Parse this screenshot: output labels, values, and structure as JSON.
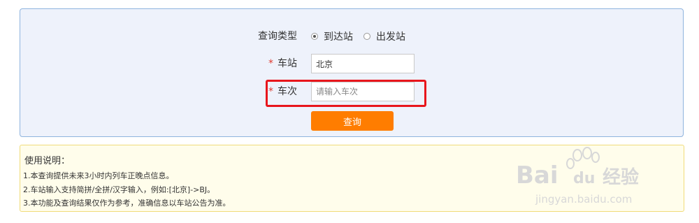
{
  "query_form": {
    "type_label": "查询类型",
    "type_options": [
      {
        "label": "到达站",
        "checked": true
      },
      {
        "label": "出发站",
        "checked": false
      }
    ],
    "station": {
      "label": "车站",
      "value": "北京"
    },
    "train": {
      "label": "车次",
      "value": "",
      "placeholder": "请输入车次"
    },
    "required_mark": "*",
    "submit_label": "查询"
  },
  "help": {
    "title": "使用说明：",
    "lines": [
      "1.本查询提供未来3小时内列车正晚点信息。",
      "2.车站输入支持简拼/全拼/汉字输入，例如:[北京]->BJ。",
      "3.本功能及查询结果仅作为参考，准确信息以车站公告为准。"
    ]
  },
  "watermark": {
    "brand": "Bai",
    "brand_du": "du",
    "brand_cn": "经验",
    "url": "jingyan.baidu.com"
  },
  "colors": {
    "accent": "#ff7d00",
    "highlight": "#e8161c",
    "panel_bg": "#eef2fb",
    "help_bg": "#fffdeb"
  }
}
